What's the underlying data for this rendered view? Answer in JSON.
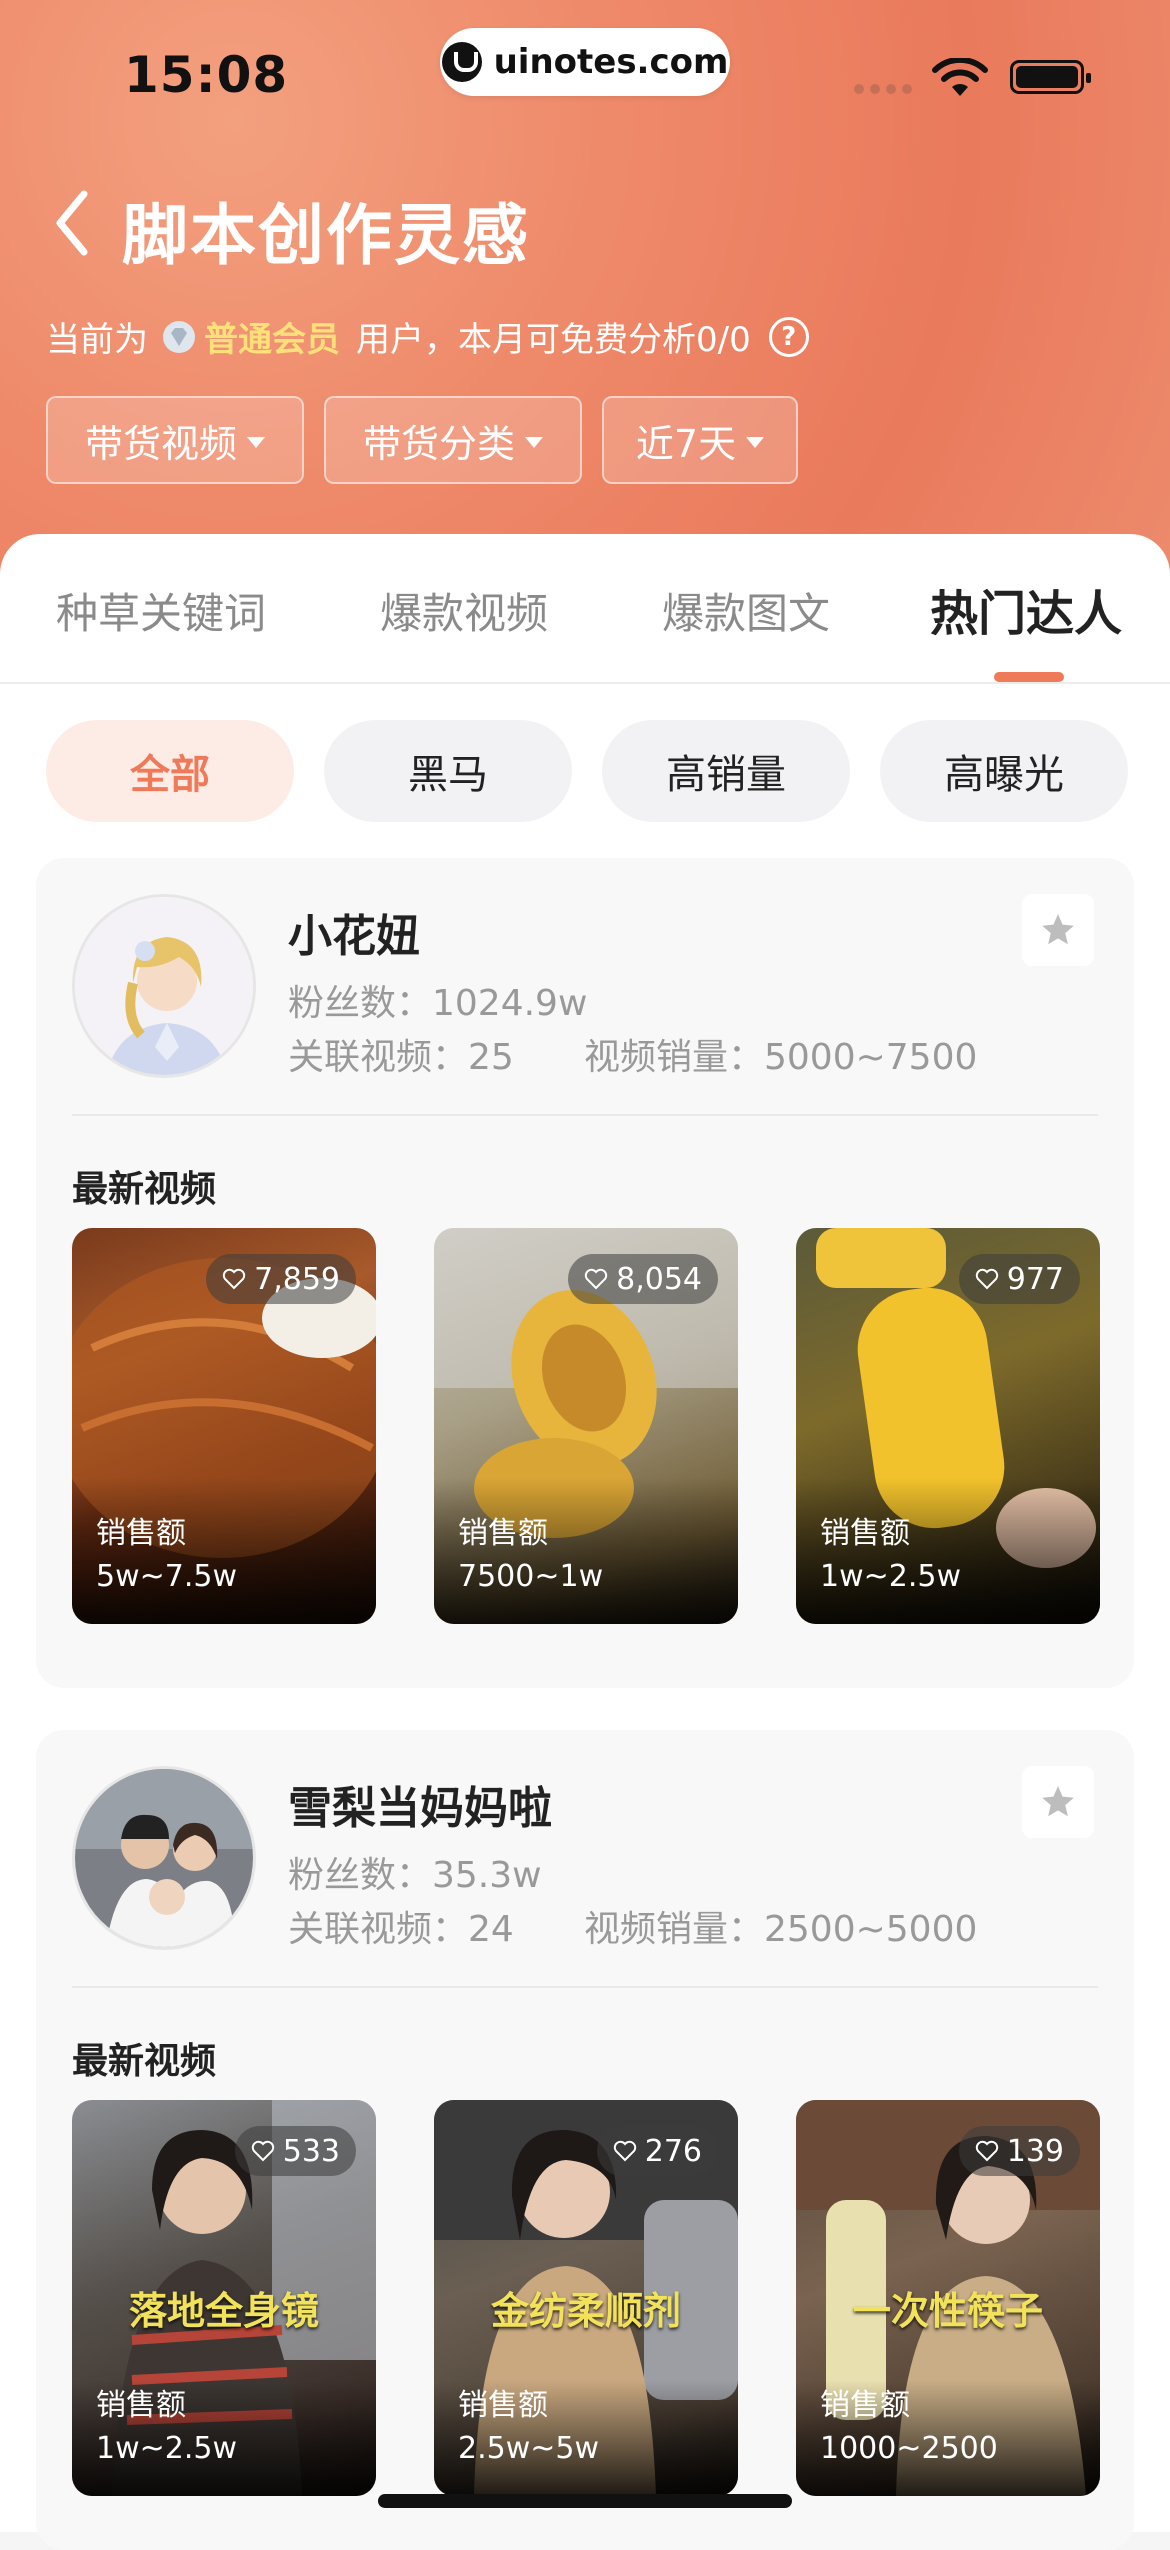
{
  "status_bar": {
    "time": "15:08",
    "url": "uinotes.com"
  },
  "header": {
    "title": "脚本创作灵感",
    "member_prefix": "当前为",
    "member_level": "普通会员",
    "member_suffix": "用户，本月可免费分析0/0",
    "filters": [
      {
        "label": "带货视频"
      },
      {
        "label": "带货分类"
      },
      {
        "label": "近7天"
      }
    ]
  },
  "tabs": [
    {
      "label": "种草关键词"
    },
    {
      "label": "爆款视频"
    },
    {
      "label": "爆款图文"
    },
    {
      "label": "热门达人",
      "active": true
    }
  ],
  "chips": [
    {
      "label": "全部",
      "active": true
    },
    {
      "label": "黑马"
    },
    {
      "label": "高销量"
    },
    {
      "label": "高曝光"
    }
  ],
  "creators": [
    {
      "name": "小花妞",
      "fans": "粉丝数：1024.9w",
      "videos": "关联视频：25",
      "sales": "视频销量：5000~7500",
      "latest_label": "最新视频",
      "videos_list": [
        {
          "likes": "7,859",
          "sale_label": "销售额",
          "sale_value": "5w~7.5w"
        },
        {
          "likes": "8,054",
          "sale_label": "销售额",
          "sale_value": "7500~1w"
        },
        {
          "likes": "977",
          "sale_label": "销售额",
          "sale_value": "1w~2.5w"
        }
      ]
    },
    {
      "name": "雪梨当妈妈啦",
      "fans": "粉丝数：35.3w",
      "videos": "关联视频：24",
      "sales": "视频销量：2500~5000",
      "latest_label": "最新视频",
      "videos_list": [
        {
          "likes": "533",
          "sale_label": "销售额",
          "sale_value": "1w~2.5w",
          "overlay": "落地全身镜"
        },
        {
          "likes": "276",
          "sale_label": "销售额",
          "sale_value": "2.5w~5w",
          "overlay": "金纺柔顺剂"
        },
        {
          "likes": "139",
          "sale_label": "销售额",
          "sale_value": "1000~2500",
          "overlay": "一次性筷子"
        }
      ]
    }
  ]
}
